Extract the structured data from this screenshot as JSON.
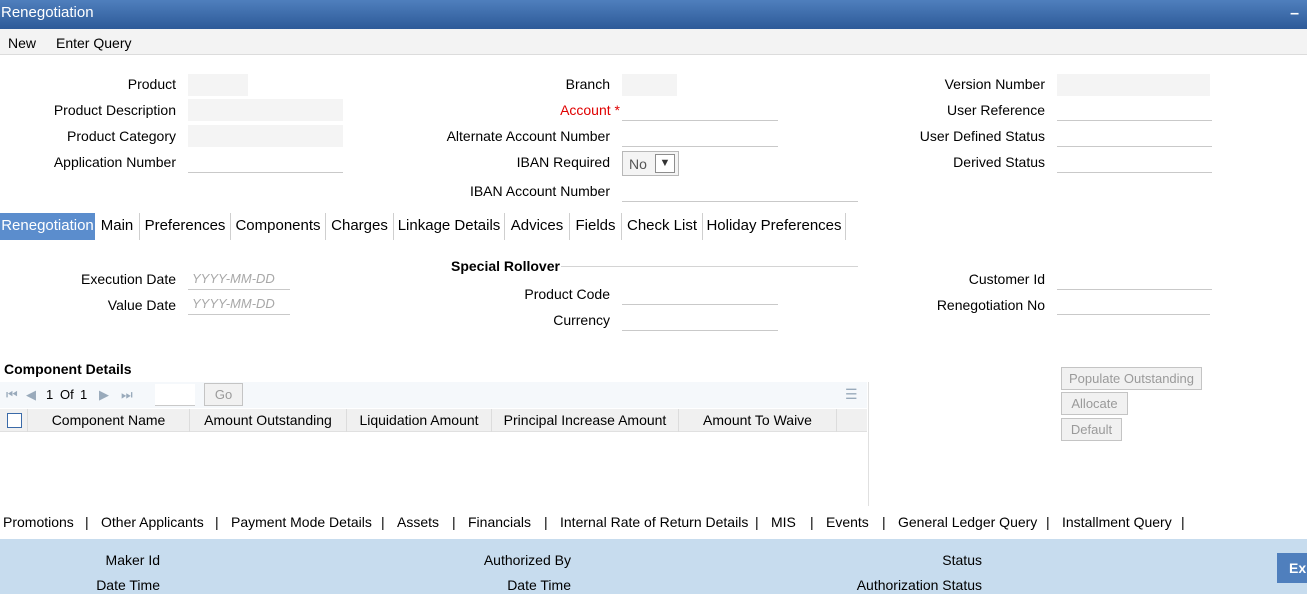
{
  "window": {
    "title": "Renegotiation",
    "minimize": "–"
  },
  "toolbar": {
    "new": "New",
    "enter_query": "Enter Query"
  },
  "header": {
    "product": "Product",
    "product_description": "Product Description",
    "product_category": "Product Category",
    "application_number": "Application Number",
    "branch": "Branch",
    "account": "Account",
    "account_required": "*",
    "alternate_account_number": "Alternate Account Number",
    "iban_required": "IBAN Required",
    "iban_required_value": "No",
    "iban_account_number": "IBAN Account Number",
    "version_number": "Version Number",
    "user_reference": "User Reference",
    "user_defined_status": "User Defined Status",
    "derived_status": "Derived Status"
  },
  "tabs": [
    "Renegotiation",
    "Main",
    "Preferences",
    "Components",
    "Charges",
    "Linkage Details",
    "Advices",
    "Fields",
    "Check List",
    "Holiday Preferences"
  ],
  "renegotiation": {
    "execution_date": "Execution Date",
    "value_date": "Value Date",
    "date_placeholder": "YYYY-MM-DD",
    "special_rollover": "Special Rollover",
    "product_code": "Product Code",
    "currency": "Currency",
    "customer_id": "Customer Id",
    "renegotiation_no": "Renegotiation No"
  },
  "component_details": {
    "title": "Component Details",
    "page_current": "1",
    "page_of": "Of",
    "page_total": "1",
    "go": "Go",
    "columns": [
      "Component Name",
      "Amount Outstanding",
      "Liquidation Amount",
      "Principal Increase Amount",
      "Amount To Waive"
    ]
  },
  "side_buttons": {
    "populate": "Populate Outstanding",
    "allocate": "Allocate",
    "default": "Default"
  },
  "bottom_links": [
    "Promotions",
    "|",
    "Other Applicants",
    "|",
    "Payment Mode Details",
    "|",
    "Assets",
    "|",
    "Financials",
    "|",
    "Internal Rate of Return Details",
    "|",
    "MIS",
    "|",
    "Events",
    "|",
    "General Ledger Query",
    "|",
    "Installment Query",
    "|"
  ],
  "footer": {
    "maker_id": "Maker Id",
    "date_time": "Date Time",
    "authorized_by": "Authorized By",
    "status": "Status",
    "authorization_status": "Authorization Status",
    "exit": "Ex"
  },
  "colors": {
    "title_bar": "#2d5a98",
    "active_tab": "#5b8dcd",
    "footer": "#c7dcee",
    "required": "#e00000"
  }
}
